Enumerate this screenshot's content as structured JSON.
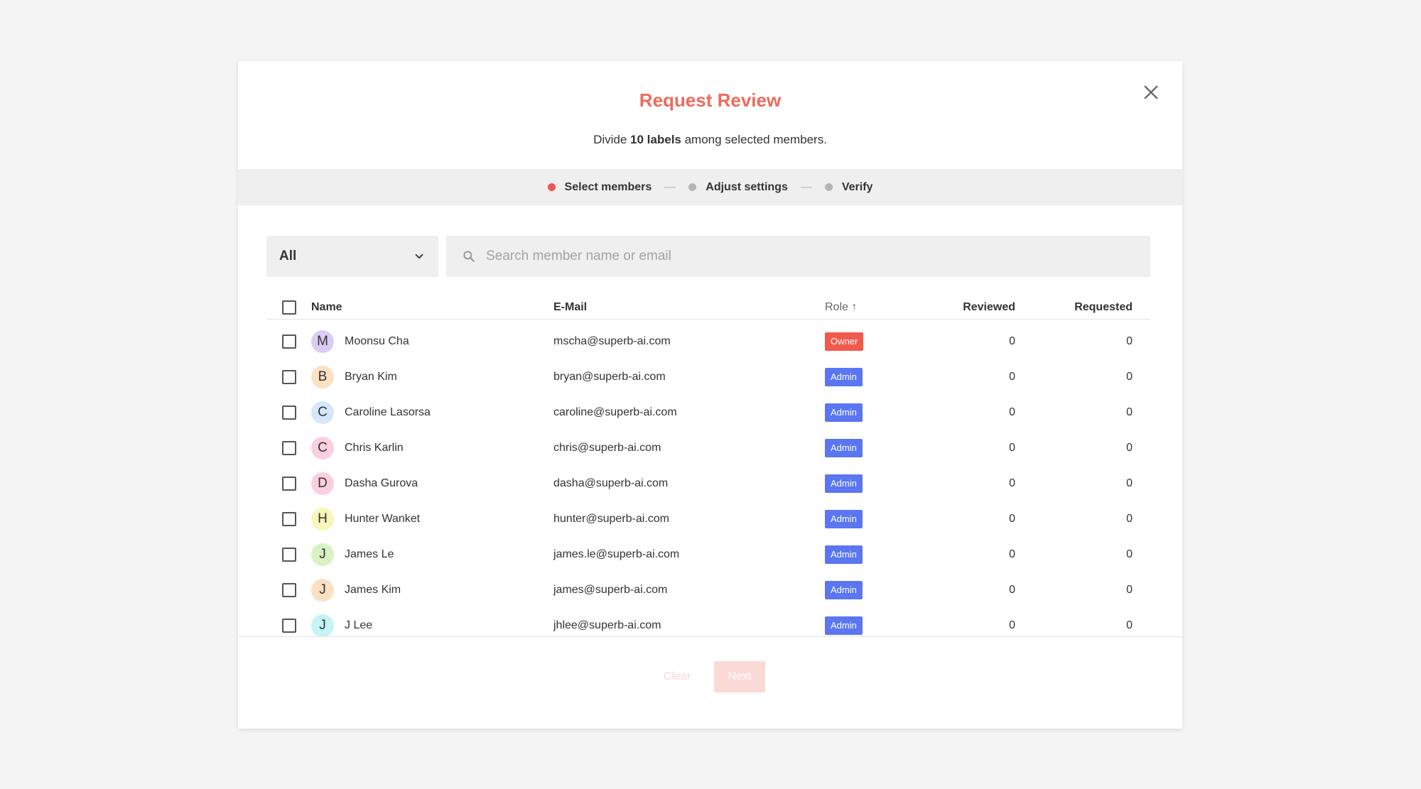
{
  "modal": {
    "title": "Request Review",
    "subtitle_prefix": "Divide ",
    "subtitle_bold": "10 labels",
    "subtitle_suffix": " among selected members."
  },
  "stepper": [
    {
      "label": "Select members",
      "active": true
    },
    {
      "label": "Adjust settings",
      "active": false
    },
    {
      "label": "Verify",
      "active": false
    }
  ],
  "filter": {
    "selected": "All"
  },
  "search": {
    "placeholder": "Search member name or email"
  },
  "table": {
    "headers": {
      "name": "Name",
      "email": "E-Mail",
      "role": "Role",
      "reviewed": "Reviewed",
      "requested": "Requested"
    },
    "rows": [
      {
        "initial": "M",
        "name": "Moonsu Cha",
        "email": "mscha@superb-ai.com",
        "role": "Owner",
        "reviewed": "0",
        "requested": "0",
        "avatar_color": "#dccbf2"
      },
      {
        "initial": "B",
        "name": "Bryan Kim",
        "email": "bryan@superb-ai.com",
        "role": "Admin",
        "reviewed": "0",
        "requested": "0",
        "avatar_color": "#fde0c4"
      },
      {
        "initial": "C",
        "name": "Caroline Lasorsa",
        "email": "caroline@superb-ai.com",
        "role": "Admin",
        "reviewed": "0",
        "requested": "0",
        "avatar_color": "#d4e7fb"
      },
      {
        "initial": "C",
        "name": "Chris Karlin",
        "email": "chris@superb-ai.com",
        "role": "Admin",
        "reviewed": "0",
        "requested": "0",
        "avatar_color": "#fbcfdd"
      },
      {
        "initial": "D",
        "name": "Dasha Gurova",
        "email": "dasha@superb-ai.com",
        "role": "Admin",
        "reviewed": "0",
        "requested": "0",
        "avatar_color": "#fbcfdd"
      },
      {
        "initial": "H",
        "name": "Hunter Wanket",
        "email": "hunter@superb-ai.com",
        "role": "Admin",
        "reviewed": "0",
        "requested": "0",
        "avatar_color": "#f6f7b8"
      },
      {
        "initial": "J",
        "name": "James Le",
        "email": "james.le@superb-ai.com",
        "role": "Admin",
        "reviewed": "0",
        "requested": "0",
        "avatar_color": "#d8f2c4"
      },
      {
        "initial": "J",
        "name": "James Kim",
        "email": "james@superb-ai.com",
        "role": "Admin",
        "reviewed": "0",
        "requested": "0",
        "avatar_color": "#fde0c4"
      },
      {
        "initial": "J",
        "name": "J Lee",
        "email": "jhlee@superb-ai.com",
        "role": "Admin",
        "reviewed": "0",
        "requested": "0",
        "avatar_color": "#c5f3f6"
      }
    ]
  },
  "footer": {
    "clear_label": "Clear",
    "next_label": "Next"
  },
  "colors": {
    "accent": "#ee6b5b",
    "owner": "#f25a4e",
    "admin": "#5a76f1",
    "inactive_dot": "#b5b5b5"
  }
}
